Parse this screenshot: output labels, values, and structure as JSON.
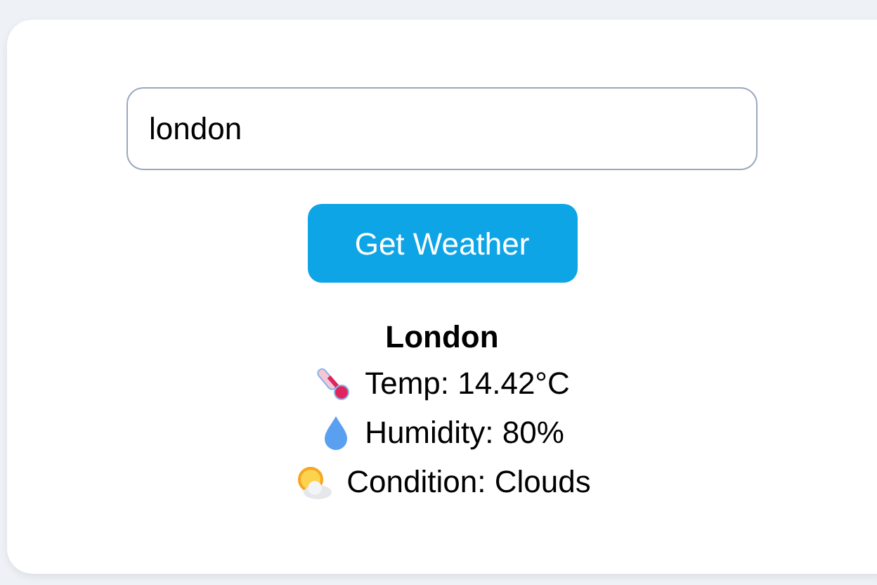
{
  "search": {
    "value": "london"
  },
  "button": {
    "label": "Get Weather"
  },
  "result": {
    "city": "London",
    "lines": [
      {
        "kind": "temp",
        "text": "Temp: 14.42°C"
      },
      {
        "kind": "humidity",
        "text": "Humidity: 80%"
      },
      {
        "kind": "condition",
        "text": "Condition: Clouds"
      }
    ]
  }
}
